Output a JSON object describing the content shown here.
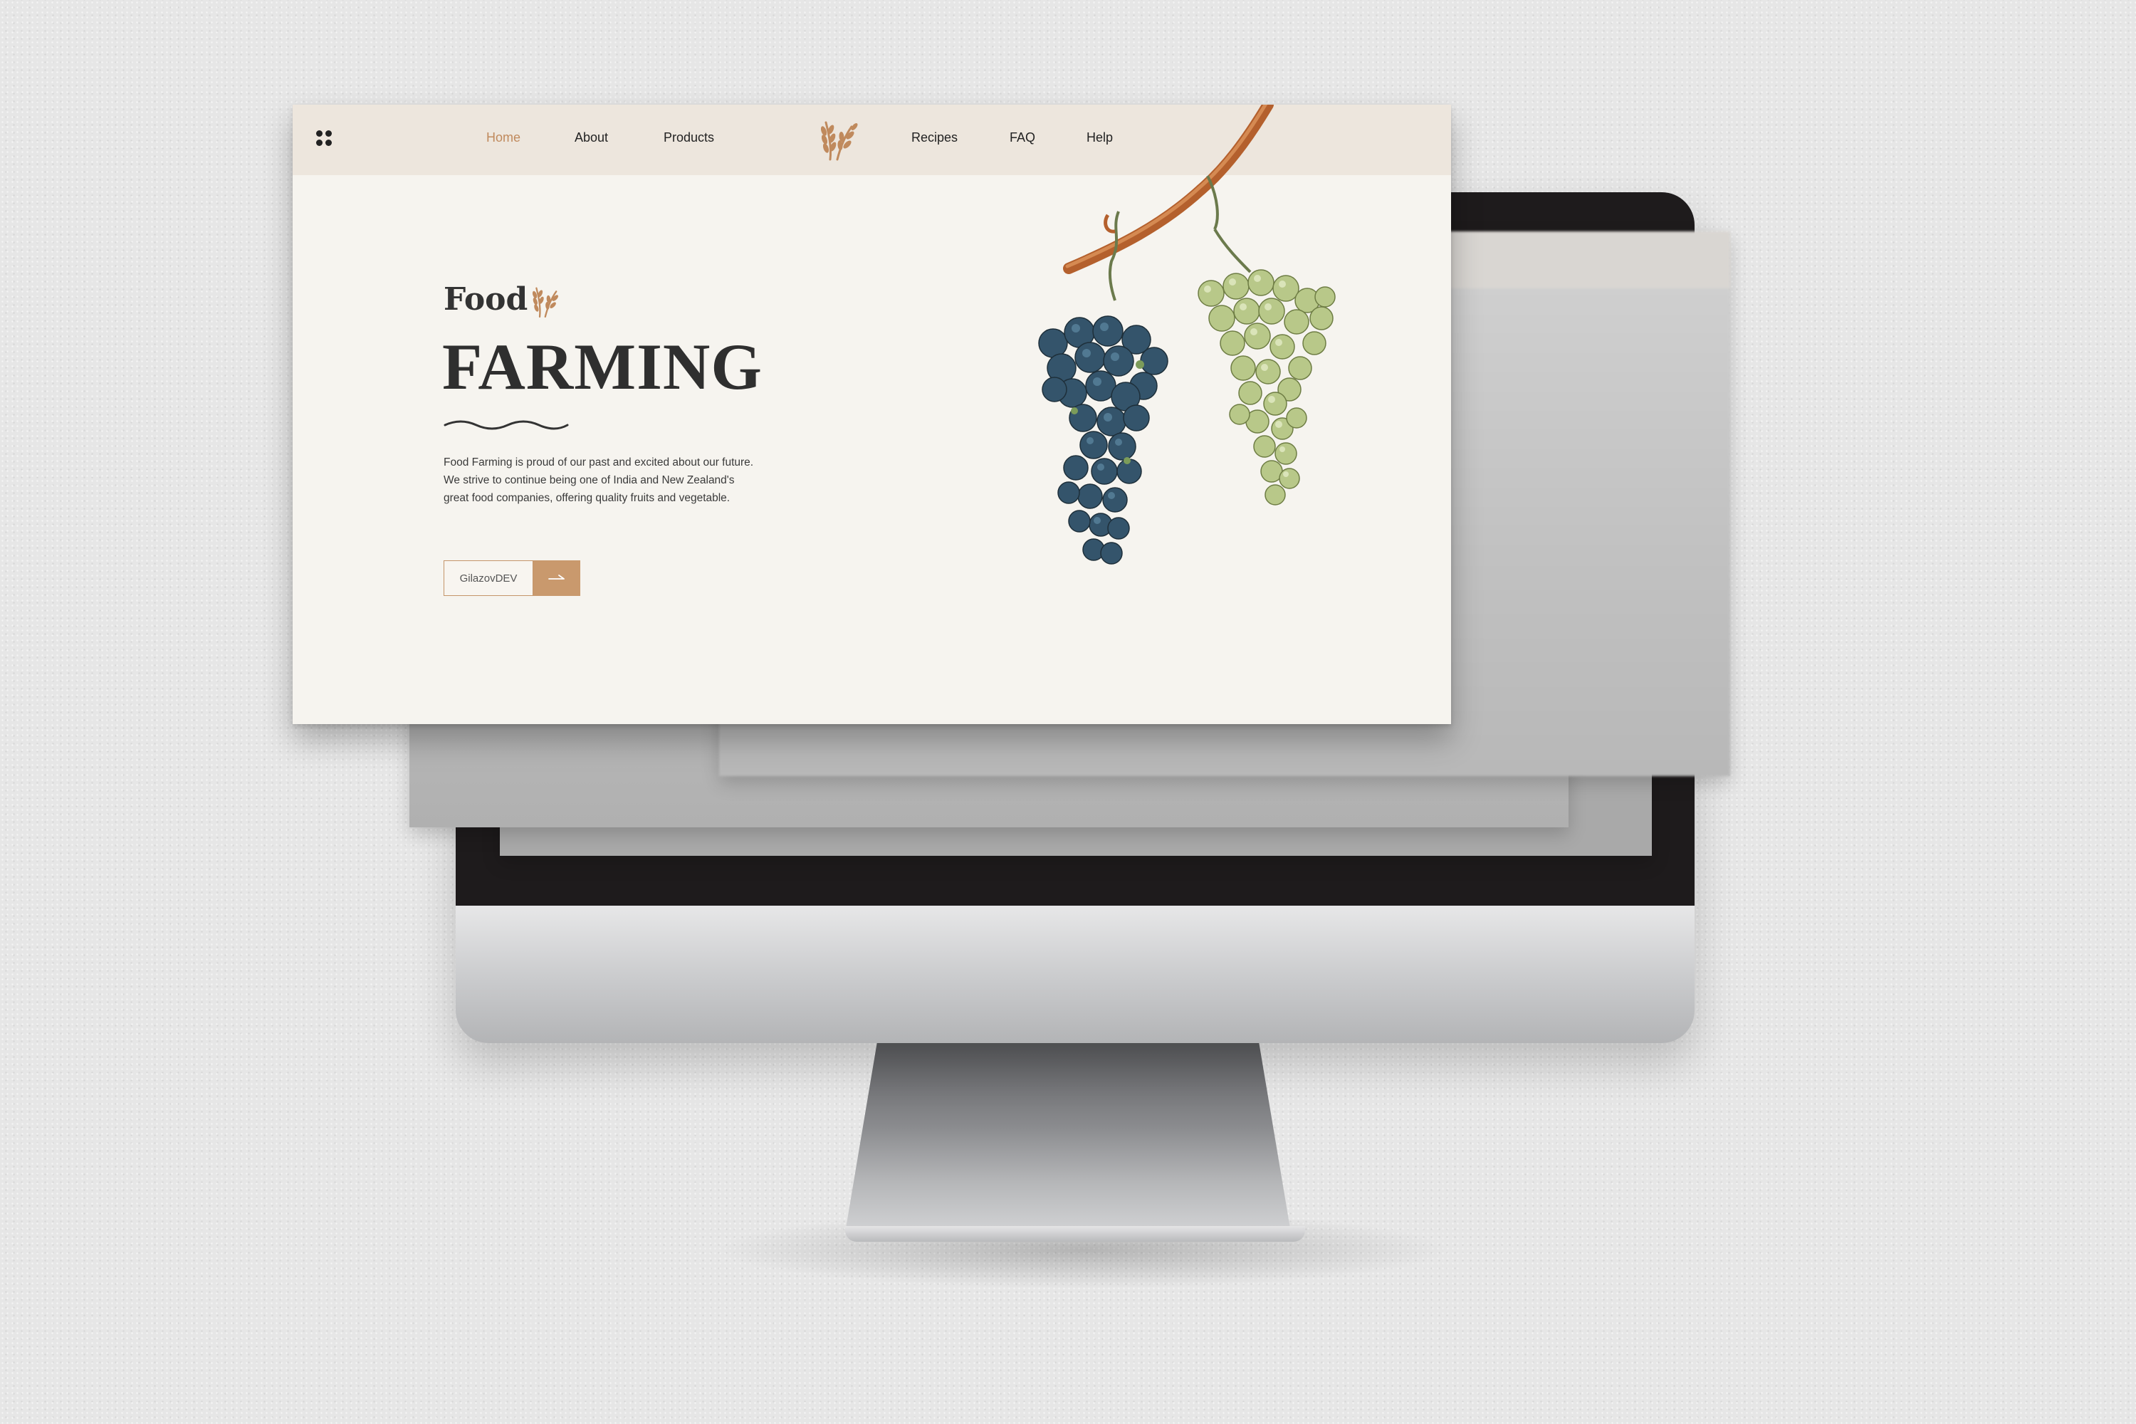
{
  "nav": {
    "items": [
      {
        "label": "Home",
        "active": true
      },
      {
        "label": "About"
      },
      {
        "label": "Products"
      },
      {
        "label": "Recipes"
      },
      {
        "label": "FAQ"
      },
      {
        "label": "Help"
      }
    ],
    "logo_icon": "wheat-icon",
    "menu_icon": "four-dots-menu-icon"
  },
  "hero": {
    "eyebrow": "Food",
    "title": "FARMING",
    "description_lines": [
      "Food Farming is proud of our past and excited about our future.",
      "We strive to continue being one of India and New Zealand's",
      "great food companies, offering quality fruits and vegetable."
    ],
    "cta_label": "GilazovDEV",
    "cta_icon": "arrow-right-icon"
  },
  "colors": {
    "accent": "#c9996d",
    "nav_bg": "#ede6dd",
    "page_bg": "#f6f4ef",
    "text_dark": "#2f2f2f"
  }
}
